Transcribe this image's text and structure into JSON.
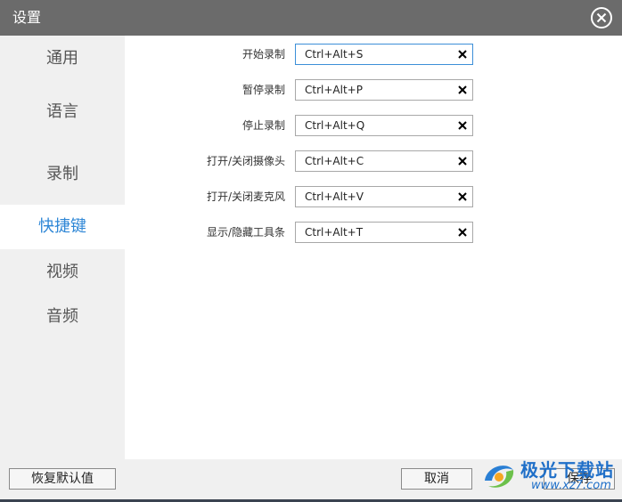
{
  "window": {
    "title": "设置"
  },
  "sidebar": {
    "items": [
      {
        "label": "通用"
      },
      {
        "label": "语言"
      },
      {
        "label": "录制"
      },
      {
        "label": "快捷键",
        "active": true
      },
      {
        "label": "视频"
      },
      {
        "label": "音频"
      }
    ]
  },
  "hotkeys": [
    {
      "label": "开始录制",
      "value": "Ctrl+Alt+S"
    },
    {
      "label": "暂停录制",
      "value": "Ctrl+Alt+P"
    },
    {
      "label": "停止录制",
      "value": "Ctrl+Alt+Q"
    },
    {
      "label": "打开/关闭摄像头",
      "value": "Ctrl+Alt+C"
    },
    {
      "label": "打开/关闭麦克风",
      "value": "Ctrl+Alt+V"
    },
    {
      "label": "显示/隐藏工具条",
      "value": "Ctrl+Alt+T"
    }
  ],
  "footer": {
    "reset_label": "恢复默认值",
    "cancel_label": "取消",
    "save_label": "保存"
  },
  "watermark": {
    "name": "极光下载站",
    "url": "www.xz7.com"
  },
  "colors": {
    "accent": "#2f87d6",
    "titlebar": "#6b6b6b"
  },
  "icons": {
    "close": "close-circle-icon",
    "clear": "x-icon",
    "logo": "swirl-logo-icon"
  }
}
